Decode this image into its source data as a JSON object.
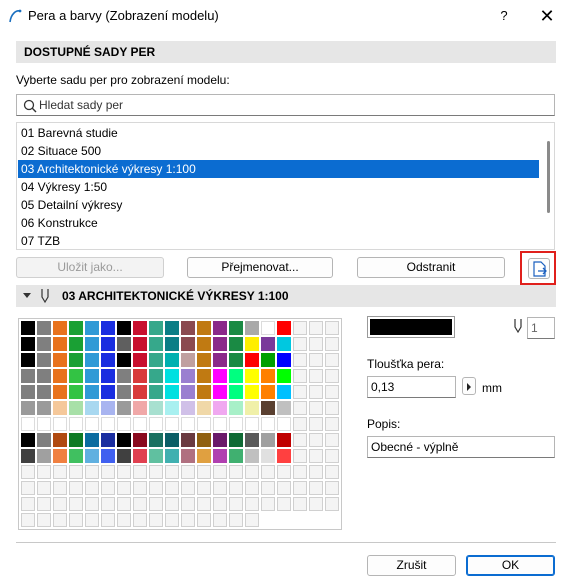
{
  "window": {
    "title": "Pera a barvy (Zobrazení modelu)",
    "help": "?",
    "close": "✕"
  },
  "section1": {
    "header": "DOSTUPNÉ SADY PER",
    "prompt": "Vyberte sadu per pro zobrazení modelu:"
  },
  "search": {
    "placeholder": "Hledat sady per"
  },
  "pen_sets": [
    "01 Barevná studie",
    "02 Situace 500",
    "03 Architektonické výkresy 1:100",
    "04 Výkresy 1:50",
    "05 Detailní výkresy",
    "06 Konstrukce",
    "07 TZB"
  ],
  "selected_index": 2,
  "buttons": {
    "save_as": "Uložit jako...",
    "rename": "Přejmenovat...",
    "delete": "Odstranit",
    "cancel": "Zrušit",
    "ok": "OK"
  },
  "section2": {
    "header": "03 ARCHITEKTONICKÉ VÝKRESY 1:100"
  },
  "pen": {
    "number": "1",
    "thickness_label": "Tloušťka pera:",
    "thickness_value": "0,13",
    "unit": "mm",
    "description_label": "Popis:",
    "description_value": "Obecné - výplně",
    "color": "#000000"
  },
  "palette_rows": [
    [
      "#000000",
      "#7f7f7f",
      "#e8721c",
      "#1aa034",
      "#2f9ad6",
      "#1a2ee0",
      "#000000",
      "#c8102e",
      "#36a88b",
      "#0b7e86",
      "#8b4a50",
      "#c07a12",
      "#8a2a8a",
      "#1a8a44",
      "#a9a9a9",
      "#ffffff",
      "#ff0000"
    ],
    [
      "#000000",
      "#7f7f7f",
      "#e8721c",
      "#1aa034",
      "#2f9ad6",
      "#1a2ee0",
      "#5f5f5f",
      "#c8102e",
      "#36a88b",
      "#0b7e86",
      "#8b4a50",
      "#c07a12",
      "#8a2a8a",
      "#1a8a44",
      "#ffee00",
      "#7a3a9a",
      "#00c8e0"
    ],
    [
      "#000000",
      "#7f7f7f",
      "#e8721c",
      "#1aa034",
      "#2f9ad6",
      "#1a2ee0",
      "#000000",
      "#c8102e",
      "#36a88b",
      "#00b0b0",
      "#c0a0a0",
      "#c07a12",
      "#8a2a8a",
      "#1a8a44",
      "#ff0000",
      "#00a000",
      "#0000ff"
    ],
    [
      "#7f7f7f",
      "#7f7f7f",
      "#e8721c",
      "#33c344",
      "#2f9ad6",
      "#1a2ee0",
      "#7f7f7f",
      "#d83a3a",
      "#36a88b",
      "#00e0e0",
      "#9a7fd0",
      "#c07a12",
      "#ff00ff",
      "#00ff80",
      "#ffff00",
      "#ff8000",
      "#00ff00"
    ],
    [
      "#7f7f7f",
      "#7f7f7f",
      "#e8721c",
      "#33c344",
      "#2f9ad6",
      "#1a2ee0",
      "#7f7f7f",
      "#d83a3a",
      "#36a88b",
      "#00e0e0",
      "#9a7fd0",
      "#c07a12",
      "#ff00ff",
      "#00ff80",
      "#ffff00",
      "#ff8000",
      "#00c0ff"
    ],
    [
      "#9a9a9a",
      "#9a9a9a",
      "#f5c89a",
      "#a8e0a8",
      "#a8d8f0",
      "#a8b4f0",
      "#9a9a9a",
      "#f0a8a8",
      "#a8e0d0",
      "#a8f0f0",
      "#d0c0e8",
      "#f0d8a8",
      "#f0a8f0",
      "#a8f0c8",
      "#f0f0a8",
      "#5a4030",
      "#c0c0c0"
    ],
    [
      "#ffffff",
      "#ffffff",
      "#ffffff",
      "#ffffff",
      "#ffffff",
      "#ffffff",
      "#ffffff",
      "#ffffff",
      "#ffffff",
      "#ffffff",
      "#ffffff",
      "#ffffff",
      "#ffffff",
      "#ffffff",
      "#ffffff",
      "#ffffff",
      "#ffffff"
    ],
    [
      "#000000",
      "#7f7f7f",
      "#b04a10",
      "#0f7a24",
      "#0b6ca0",
      "#1a2ea0",
      "#000000",
      "#8a0a1e",
      "#1a7060",
      "#0b5e66",
      "#6a3a40",
      "#906010",
      "#6a1a6a",
      "#0f6a34",
      "#5a5a5a",
      "#a0a0a0",
      "#c00000"
    ],
    [
      "#404040",
      "#a0a0a0",
      "#f08040",
      "#40c060",
      "#60b0e0",
      "#4060f0",
      "#404040",
      "#e04050",
      "#60c0a0",
      "#40b0b0",
      "#b07080",
      "#e0a040",
      "#b040b0",
      "#40b070",
      "#c0c0c0",
      "#e0e0e0",
      "#ff4040"
    ]
  ]
}
